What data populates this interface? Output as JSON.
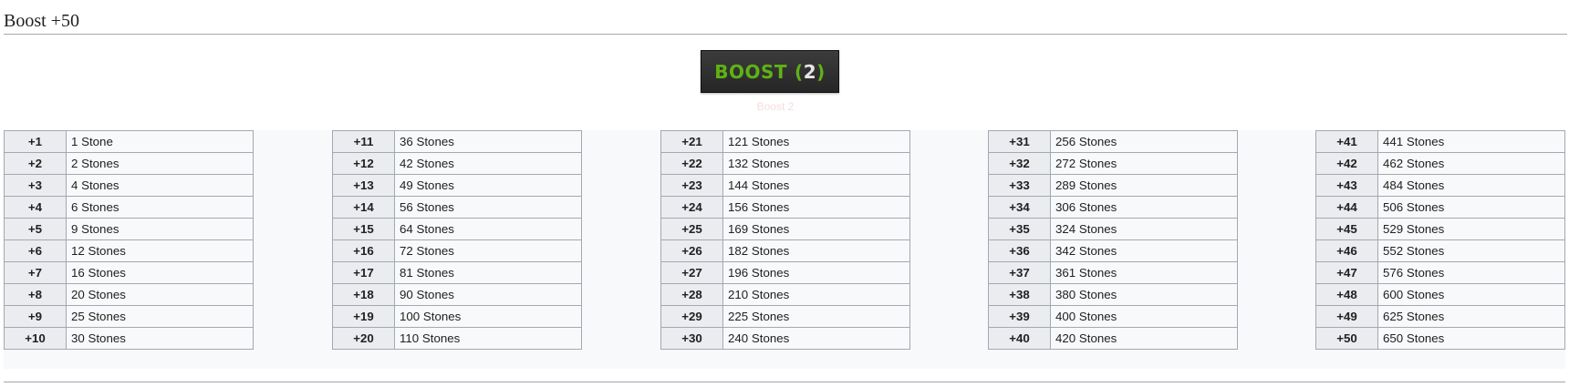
{
  "heading": "Boost +50",
  "boost_button": {
    "word": "BOOST",
    "open_paren": "(",
    "count": "2",
    "close_paren": ")"
  },
  "caption": "Boost 2",
  "tables": [
    {
      "rows": [
        {
          "level": "+1",
          "cost": "1 Stone"
        },
        {
          "level": "+2",
          "cost": "2 Stones"
        },
        {
          "level": "+3",
          "cost": "4 Stones"
        },
        {
          "level": "+4",
          "cost": "6 Stones"
        },
        {
          "level": "+5",
          "cost": "9 Stones"
        },
        {
          "level": "+6",
          "cost": "12 Stones"
        },
        {
          "level": "+7",
          "cost": "16 Stones"
        },
        {
          "level": "+8",
          "cost": "20 Stones"
        },
        {
          "level": "+9",
          "cost": "25 Stones"
        },
        {
          "level": "+10",
          "cost": "30 Stones"
        }
      ]
    },
    {
      "rows": [
        {
          "level": "+11",
          "cost": "36 Stones"
        },
        {
          "level": "+12",
          "cost": "42 Stones"
        },
        {
          "level": "+13",
          "cost": "49 Stones"
        },
        {
          "level": "+14",
          "cost": "56 Stones"
        },
        {
          "level": "+15",
          "cost": "64 Stones"
        },
        {
          "level": "+16",
          "cost": "72 Stones"
        },
        {
          "level": "+17",
          "cost": "81 Stones"
        },
        {
          "level": "+18",
          "cost": "90 Stones"
        },
        {
          "level": "+19",
          "cost": "100 Stones"
        },
        {
          "level": "+20",
          "cost": "110 Stones"
        }
      ]
    },
    {
      "rows": [
        {
          "level": "+21",
          "cost": "121 Stones"
        },
        {
          "level": "+22",
          "cost": "132 Stones"
        },
        {
          "level": "+23",
          "cost": "144 Stones"
        },
        {
          "level": "+24",
          "cost": "156 Stones"
        },
        {
          "level": "+25",
          "cost": "169 Stones"
        },
        {
          "level": "+26",
          "cost": "182 Stones"
        },
        {
          "level": "+27",
          "cost": "196 Stones"
        },
        {
          "level": "+28",
          "cost": "210 Stones"
        },
        {
          "level": "+29",
          "cost": "225 Stones"
        },
        {
          "level": "+30",
          "cost": "240 Stones"
        }
      ]
    },
    {
      "rows": [
        {
          "level": "+31",
          "cost": "256 Stones"
        },
        {
          "level": "+32",
          "cost": "272 Stones"
        },
        {
          "level": "+33",
          "cost": "289 Stones"
        },
        {
          "level": "+34",
          "cost": "306 Stones"
        },
        {
          "level": "+35",
          "cost": "324 Stones"
        },
        {
          "level": "+36",
          "cost": "342 Stones"
        },
        {
          "level": "+37",
          "cost": "361 Stones"
        },
        {
          "level": "+38",
          "cost": "380 Stones"
        },
        {
          "level": "+39",
          "cost": "400 Stones"
        },
        {
          "level": "+40",
          "cost": "420 Stones"
        }
      ]
    },
    {
      "rows": [
        {
          "level": "+41",
          "cost": "441 Stones"
        },
        {
          "level": "+42",
          "cost": "462 Stones"
        },
        {
          "level": "+43",
          "cost": "484 Stones"
        },
        {
          "level": "+44",
          "cost": "506 Stones"
        },
        {
          "level": "+45",
          "cost": "529 Stones"
        },
        {
          "level": "+46",
          "cost": "552 Stones"
        },
        {
          "level": "+47",
          "cost": "576 Stones"
        },
        {
          "level": "+48",
          "cost": "600 Stones"
        },
        {
          "level": "+49",
          "cost": "625 Stones"
        },
        {
          "level": "+50",
          "cost": "650 Stones"
        }
      ]
    }
  ]
}
